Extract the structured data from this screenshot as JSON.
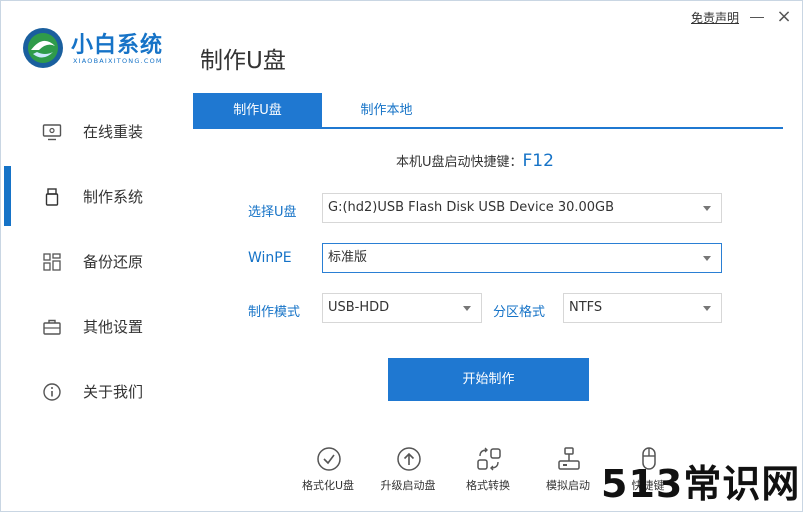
{
  "app": {
    "brand_name": "小白系统",
    "brand_sub": "XIAOBAIXITONG.COM",
    "page_title": "制作U盘",
    "disclaimer": "免责声明",
    "close_glyph": "×"
  },
  "sidebar": {
    "items": [
      {
        "label": "在线重装",
        "icon": "monitor-icon",
        "active": false
      },
      {
        "label": "制作系统",
        "icon": "usb-drive-icon",
        "active": true
      },
      {
        "label": "备份还原",
        "icon": "backup-icon",
        "active": false
      },
      {
        "label": "其他设置",
        "icon": "briefcase-icon",
        "active": false
      },
      {
        "label": "关于我们",
        "icon": "info-icon",
        "active": false
      }
    ]
  },
  "tabs": [
    {
      "label": "制作U盘",
      "active": true
    },
    {
      "label": "制作本地",
      "active": false
    }
  ],
  "hotkey": {
    "label": "本机U盘启动快捷键：",
    "key": "F12"
  },
  "form": {
    "usb_label": "选择U盘",
    "usb_value": "G:(hd2)USB Flash Disk USB Device 30.00GB",
    "winpe_label": "WinPE",
    "winpe_value": "标准版",
    "mode_label": "制作模式",
    "mode_value": "USB-HDD",
    "partition_label": "分区格式",
    "partition_value": "NTFS"
  },
  "start_button": "开始制作",
  "tools": [
    {
      "label": "格式化U盘",
      "icon": "check-circle-icon"
    },
    {
      "label": "升级启动盘",
      "icon": "upgrade-icon"
    },
    {
      "label": "格式转换",
      "icon": "convert-icon"
    },
    {
      "label": "模拟启动",
      "icon": "simulate-icon"
    },
    {
      "label": "快捷键",
      "icon": "mouse-icon"
    }
  ],
  "watermark": "513常识网",
  "colors": {
    "accent": "#1f78d1",
    "brand": "#1673c7",
    "text": "#333333"
  }
}
